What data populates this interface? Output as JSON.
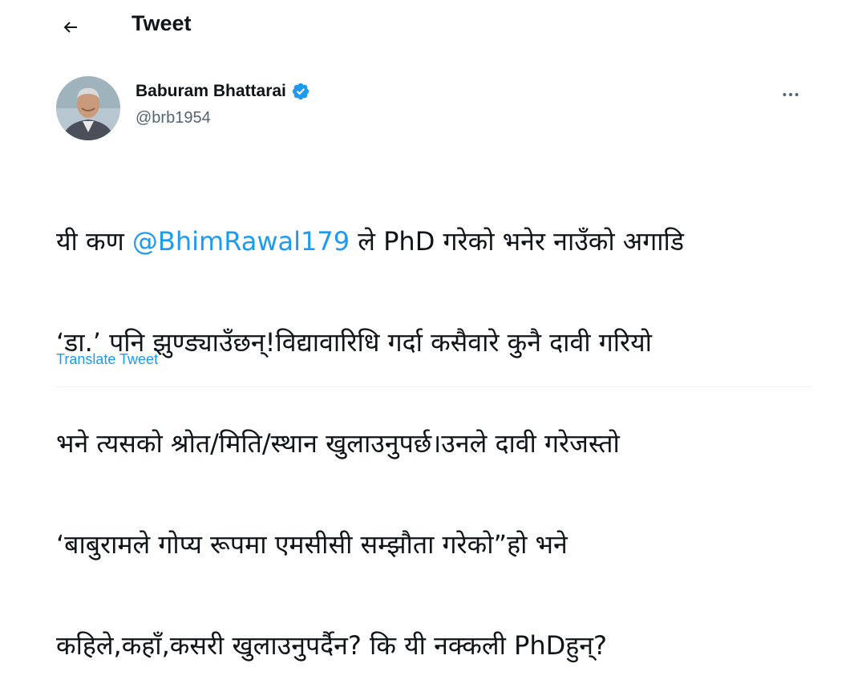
{
  "header": {
    "title": "Tweet",
    "back_icon": "arrow-left-icon"
  },
  "author": {
    "name": "Baburam Bhattarai",
    "handle": "@brb1954",
    "verified": true,
    "verified_color": "#1d9bf0"
  },
  "tweet": {
    "lines": [
      {
        "before": "यी कण ",
        "mention": "@BhimRawal179",
        "after": " ले PhD गरेको भनेर नाउँको अगाडि"
      },
      {
        "text": "‘डा.’ पनि झुण्ड्याउँछन्!विद्यावारिधि गर्दा कसैवारे कुनै दावी गरियो"
      },
      {
        "text": "भने त्यसको श्रोत/मिति/स्थान खुलाउनुपर्छ।उनले दावी गरेजस्तो"
      },
      {
        "text": "‘बाबुराम‍ले गोप्य रूपमा एमसीसी सम्झौता गरेको”हो भने"
      },
      {
        "text": "कहिले,कहाँ,कसरी खुलाउनुपर्दैन? कि यी नक्कली PhDहुन्?"
      }
    ],
    "translate_label": "Translate Tweet"
  },
  "colors": {
    "link": "#1d9bf0",
    "text": "#0f1419",
    "secondary": "#536471"
  }
}
